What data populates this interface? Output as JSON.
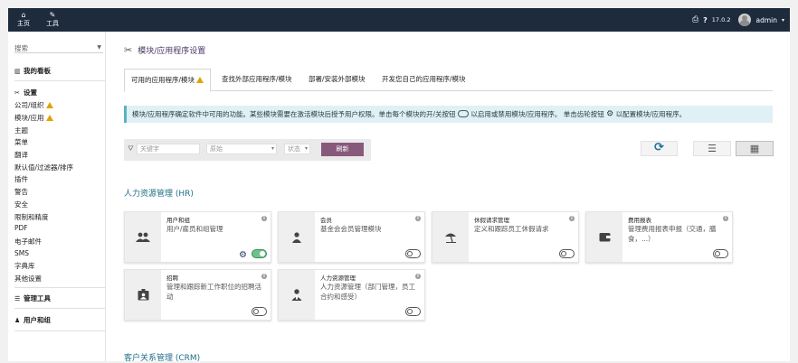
{
  "topbar": {
    "nav": [
      {
        "label": "主页",
        "icon": "home-icon",
        "glyph": "⌂"
      },
      {
        "label": "工具",
        "icon": "wrench-icon",
        "glyph": "✎"
      }
    ],
    "version": "17.0.2",
    "user": "admin"
  },
  "sidebar": {
    "search_placeholder": "搜索",
    "dashboard": "我的看板",
    "settings": "设置",
    "items": [
      "公司/组织",
      "模块/应用",
      "主题",
      "菜单",
      "翻译",
      "默认值/过滤器/排序",
      "插件",
      "警告",
      "安全",
      "限制和精度",
      "PDF",
      "电子邮件",
      "SMS",
      "字典库",
      "其他设置"
    ],
    "admin_tools": "管理工具",
    "users_groups": "用户和组"
  },
  "page": {
    "title": "模块/应用程序设置",
    "tabs": [
      "可用的应用程序/模块",
      "查找外部应用程序/模块",
      "部署/安装外部模块",
      "开发您自己的应用程序/模块"
    ],
    "info_part1": "模块/应用程序确定软件中可用的功能。某些模块需要在激活模块后授予用户权限。单击每个模块的开/关按钮",
    "info_part2": "以启用或禁用模块/应用程序。 单击齿轮按钮",
    "info_part3": "以配置模块/应用程序。",
    "filter": {
      "keyword_placeholder": "关键字",
      "origin_placeholder": "原始",
      "status_placeholder": "状态",
      "refresh_label": "刷新"
    }
  },
  "sections": [
    {
      "title": "人力资源管理 (HR)",
      "cards": [
        {
          "title": "用户和组",
          "desc": "用户/雇员和组管理",
          "icon": "users-icon",
          "glyph": "👥",
          "enabled": true
        },
        {
          "title": "会员",
          "desc": "基金会会员管理模块",
          "icon": "member-icon",
          "glyph": "👤",
          "enabled": false
        },
        {
          "title": "休假请求管理",
          "desc": "定义和跟踪员工休假请求",
          "icon": "beach-umbrella-icon",
          "glyph": "⛱",
          "enabled": false
        },
        {
          "title": "费用报表",
          "desc": "管理费用报表申报（交通，膳食，...）",
          "icon": "wallet-icon",
          "glyph": "▣",
          "enabled": false
        },
        {
          "title": "招聘",
          "desc": "管理和跟踪新工作职位的招聘活动",
          "icon": "id-badge-icon",
          "glyph": "▤",
          "enabled": false
        },
        {
          "title": "人力资源管理",
          "desc": "人力资源管理（部门管理，员工合约和感受）",
          "icon": "user-tie-icon",
          "glyph": "👤",
          "enabled": false
        }
      ]
    },
    {
      "title": "客户关系管理 (CRM)",
      "cards": []
    }
  ],
  "colors": {
    "topbar_bg": "#1d2b3c",
    "accent": "#875a7b",
    "section_title": "#1d6e87",
    "info_bg": "#dff1f4",
    "toggle_on": "#6cc48b"
  }
}
